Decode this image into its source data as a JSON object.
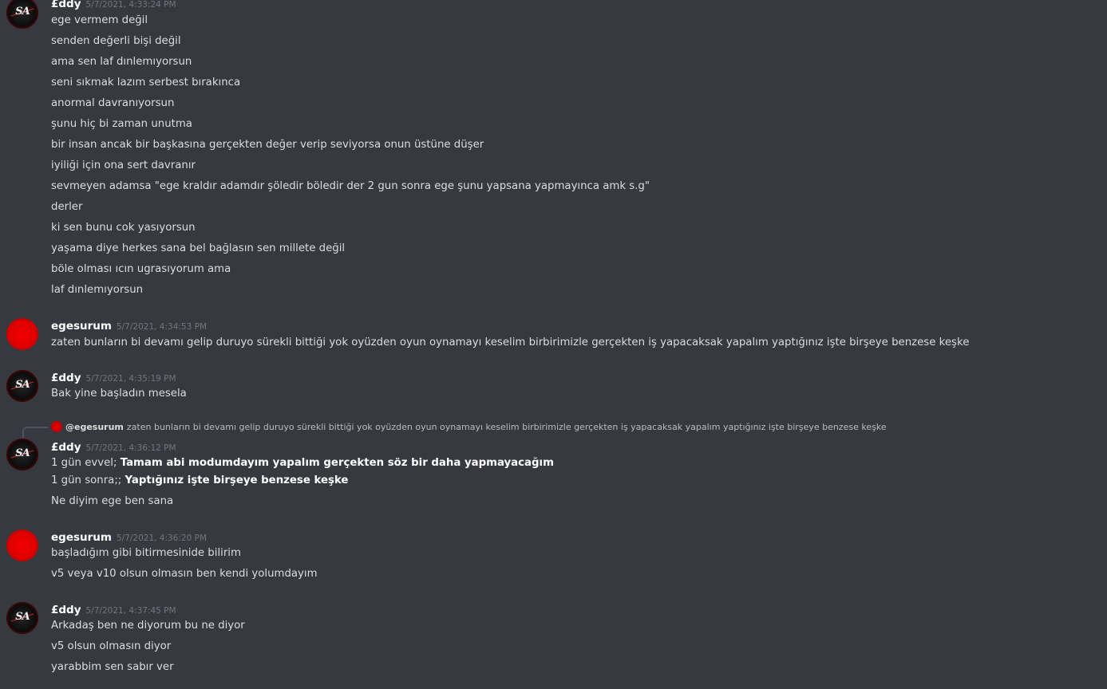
{
  "messages": {
    "g1": {
      "username": "£ddy",
      "timestamp": "5/7/2021, 4:33:24 PM",
      "lines": [
        "ege vermem değil",
        "senden değerli bişi değil",
        "ama sen laf dınlemıyorsun",
        "seni sıkmak lazım serbest bırakınca",
        "anormal davranıyorsun",
        "şunu hiç bi zaman unutma",
        "bir insan ancak bir başkasına gerçekten değer verip seviyorsa onun üstüne düşer",
        "iyiliği için ona sert davranır",
        "sevmeyen adamsa \"ege kraldır adamdır şöledir böledir der 2 gun sonra ege şunu yapsana yapmayınca amk s.g\"",
        "derler",
        "ki sen bunu cok yasıyorsun",
        "yaşama diye herkes sana bel bağlasın sen millete değil",
        "böle olması ıcın ugrasıyorum ama",
        "laf dınlemıyorsun"
      ]
    },
    "g2": {
      "username": "egesurum",
      "timestamp": "5/7/2021, 4:34:53 PM",
      "lines": [
        "zaten bunların bi devamı gelip duruyo sürekli bittiği yok oyüzden oyun oynamayı keselim birbirimizle gerçekten iş yapacaksak yapalım yaptığınız işte birşeye benzese keşke"
      ]
    },
    "g3": {
      "username": "£ddy",
      "timestamp": "5/7/2021, 4:35:19 PM",
      "lines": [
        "Bak yine başladın mesela"
      ]
    },
    "g4": {
      "reply": {
        "mention": "@egesurum",
        "text": "zaten bunların bi devamı gelip duruyo sürekli bittiği yok oyüzden oyun oynamayı keselim birbirimizle gerçekten iş yapacaksak yapalım yaptığınız işte birşeye benzese keşke"
      },
      "username": "£ddy",
      "timestamp": "5/7/2021, 4:36:12 PM",
      "line1_prefix": "1 gün evvel; ",
      "line1_bold": "Tamam abi modumdayım yapalım gerçekten söz bir daha yapmayacağım",
      "line2_prefix": "1 gün sonra;; ",
      "line2_bold": "Yaptığınız işte birşeye benzese keşke",
      "line3": "Ne diyim ege ben sana"
    },
    "g5": {
      "username": "egesurum",
      "timestamp": "5/7/2021, 4:36:20 PM",
      "lines": [
        "başladığım gibi bitirmesinide bilirim",
        "v5 veya v10 olsun olmasın ben kendi yolumdayım"
      ]
    },
    "g6": {
      "username": "£ddy",
      "timestamp": "5/7/2021, 4:37:45 PM",
      "lines": [
        "Arkadaş ben ne diyorum bu ne diyor",
        "v5 olsun olmasın diyor",
        "yarabbim sen sabır ver"
      ]
    }
  },
  "avatars": {
    "eddy_text": "SA"
  },
  "colors": {
    "background": "#36393f",
    "username": "#ffffff",
    "message_text": "#dcddde",
    "timestamp": "#72767d"
  }
}
